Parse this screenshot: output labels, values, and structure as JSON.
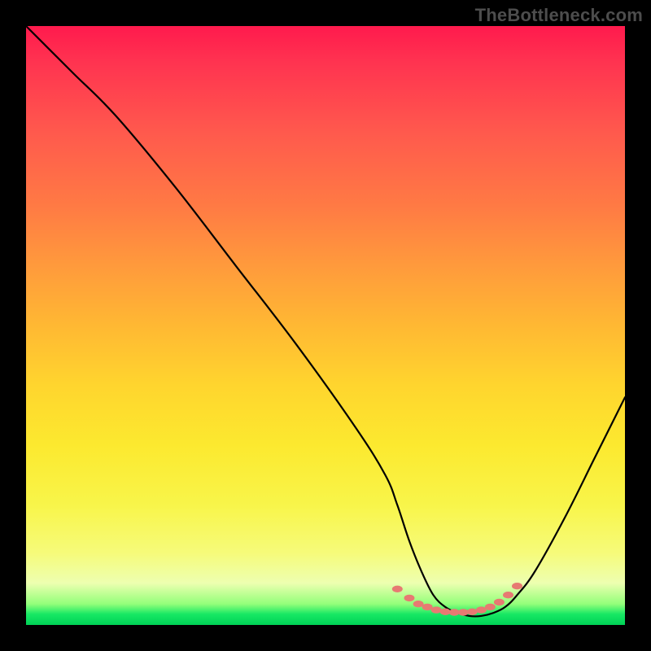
{
  "watermark": "TheBottleneck.com",
  "colors": {
    "background": "#000000",
    "gradient_top": "#ff1a4d",
    "gradient_mid": "#ffd52e",
    "gradient_bottom": "#00d256",
    "curve": "#000000",
    "marker": "#e77a72"
  },
  "chart_data": {
    "type": "line",
    "title": "",
    "xlabel": "",
    "ylabel": "",
    "xlim": [
      0,
      100
    ],
    "ylim": [
      0,
      100
    ],
    "series": [
      {
        "name": "bottleneck-curve",
        "x": [
          0,
          3,
          8,
          15,
          25,
          35,
          45,
          55,
          60,
          62,
          64,
          66,
          68,
          70,
          72,
          74,
          76,
          78,
          80,
          82,
          85,
          90,
          95,
          100
        ],
        "y": [
          100,
          97,
          92,
          85,
          73,
          60,
          47,
          33,
          25,
          20,
          14,
          9,
          5,
          3,
          2,
          1.5,
          1.5,
          2,
          3,
          5,
          9,
          18,
          28,
          38
        ]
      }
    ],
    "markers": {
      "name": "valley-dots",
      "x": [
        62,
        64,
        65.5,
        67,
        68.5,
        70,
        71.5,
        73,
        74.5,
        76,
        77.5,
        79,
        80.5,
        82
      ],
      "y": [
        6,
        4.5,
        3.5,
        3,
        2.5,
        2.2,
        2.1,
        2.1,
        2.2,
        2.5,
        3,
        3.8,
        5,
        6.5
      ]
    }
  }
}
